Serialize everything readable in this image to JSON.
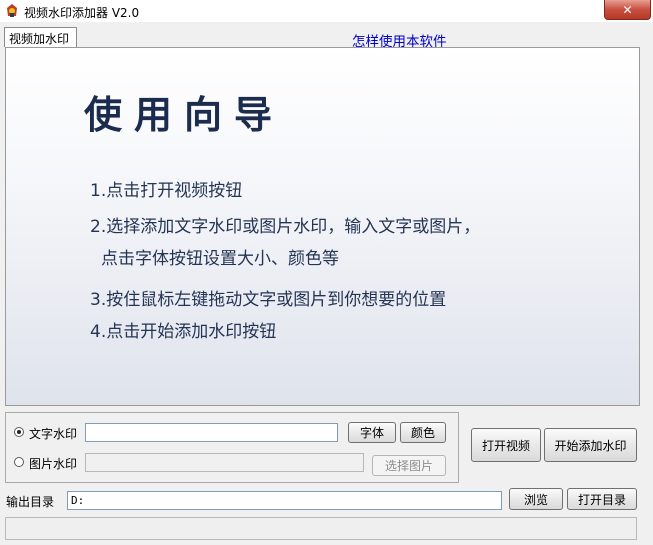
{
  "window": {
    "title": "视频水印添加器 V2.0",
    "close_glyph": "✕"
  },
  "tab": {
    "label": "视频加水印",
    "help_link": "怎样使用本软件"
  },
  "guide": {
    "title": "使用向导",
    "steps": [
      "1.点击打开视频按钮",
      "2.选择添加文字水印或图片水印，输入文字或图片，",
      "点击字体按钮设置大小、颜色等",
      "3.按住鼠标左键拖动文字或图片到你想要的位置",
      "4.点击开始添加水印按钮"
    ]
  },
  "watermark": {
    "text_option": {
      "label": "文字水印",
      "selected": true,
      "value": ""
    },
    "image_option": {
      "label": "图片水印",
      "selected": false,
      "value": ""
    },
    "font_button": "字体",
    "color_button": "颜色",
    "select_image_button": "选择图片"
  },
  "actions": {
    "open_video_button": "打开视频",
    "start_button": "开始添加水印"
  },
  "output": {
    "label": "输出目录",
    "value": "D:",
    "browse_button": "浏览",
    "open_folder_button": "打开目录"
  },
  "status": {
    "text": ""
  },
  "colors": {
    "guide_text": "#243453",
    "link": "#0000cc",
    "close_button": "#c7503f"
  }
}
